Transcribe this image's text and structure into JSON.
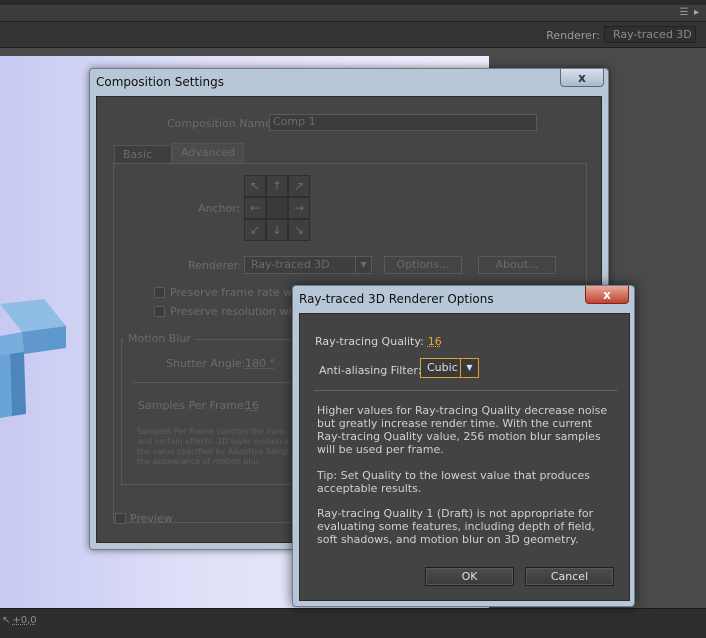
{
  "app": {
    "viewer_renderer_label": "Renderer:",
    "viewer_renderer_value": "Ray-traced 3D",
    "exposure_value": "+0,0",
    "panel_menu_icon": "panel-menu-icon",
    "panel_close_icon": "close-icon"
  },
  "comp_dialog": {
    "title": "Composition Settings",
    "close_label": "x",
    "name_label": "Composition Name:",
    "name_value": "Comp 1",
    "tabs": [
      {
        "label": "Basic"
      },
      {
        "label": "Advanced"
      }
    ],
    "anchor_label": "Anchor:",
    "anchor_arrows": [
      "↖",
      "↑",
      "↗",
      "←",
      "",
      "→",
      "↙",
      "↓",
      "↘"
    ],
    "renderer_label": "Renderer:",
    "renderer_value": "Ray-traced 3D",
    "options_button": "Options...",
    "about_button": "About...",
    "preserve_frame_rate": "Preserve frame rate whe",
    "preserve_resolution": "Preserve resolution whe",
    "motion_blur_legend": "Motion Blur",
    "shutter_angle_label": "Shutter Angle:",
    "shutter_angle_value": "180 °",
    "samples_label": "Samples Per Frame:",
    "samples_value": "16",
    "note_lines": [
      "Samples Per Frame controls the num",
      "and certain effects. 2D layer motion a",
      "the value specified by Adaptive Samp",
      "the appearance of motion blur."
    ],
    "preview_label": "Preview"
  },
  "rt_dialog": {
    "title": "Ray-traced 3D Renderer Options",
    "close_label": "x",
    "quality_label": "Ray-tracing Quality:",
    "quality_value": "16",
    "filter_label": "Anti-aliasing Filter:",
    "filter_value": "Cubic",
    "para1": "Higher values for Ray-tracing Quality decrease noise but greatly increase render time. With the current Ray-tracing Quality value, 256 motion blur samples will be used per frame.",
    "para2": "Tip: Set Quality to the lowest value that produces acceptable results.",
    "para3": "Ray-tracing Quality 1 (Draft) is not appropriate for evaluating some features, including depth of field, soft shadows, and motion blur on 3D geometry.",
    "ok_button": "OK",
    "cancel_button": "Cancel"
  },
  "colors": {
    "accent_orange": "#e0a030",
    "close_red": "#c0432e",
    "dialog_frame": "#b7c7d8"
  }
}
